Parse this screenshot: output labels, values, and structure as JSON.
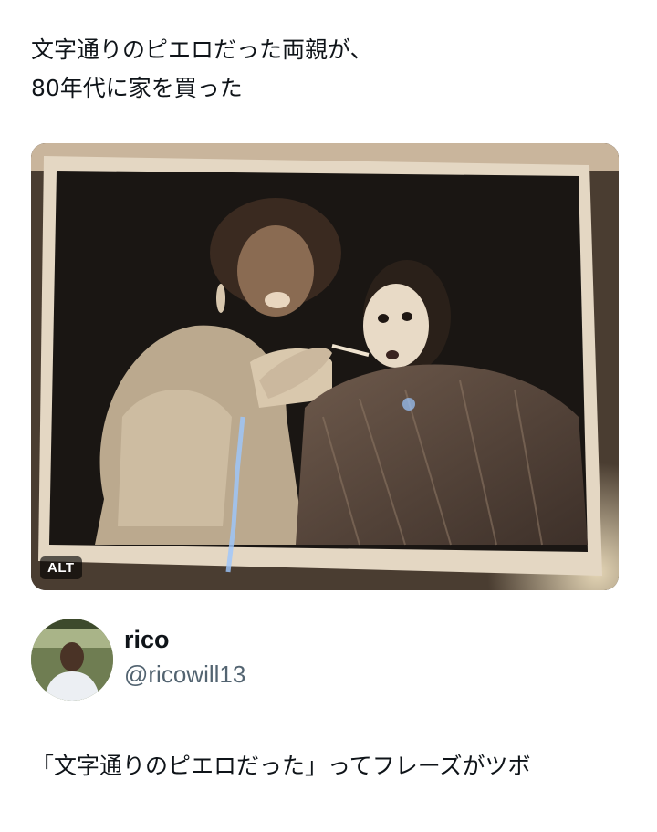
{
  "post": {
    "text": "文字通りのピエロだった両親が、\n80年代に家を買った"
  },
  "media": {
    "alt_badge": "ALT",
    "icon": "photo-of-two-clowns"
  },
  "author": {
    "display_name": "rico",
    "handle": "@ricowill13"
  },
  "reply": {
    "text": "「文字通りのピエロだった」ってフレーズがツボ"
  },
  "colors": {
    "text": "#0f1419",
    "secondary_text": "#536471",
    "background": "#ffffff"
  }
}
